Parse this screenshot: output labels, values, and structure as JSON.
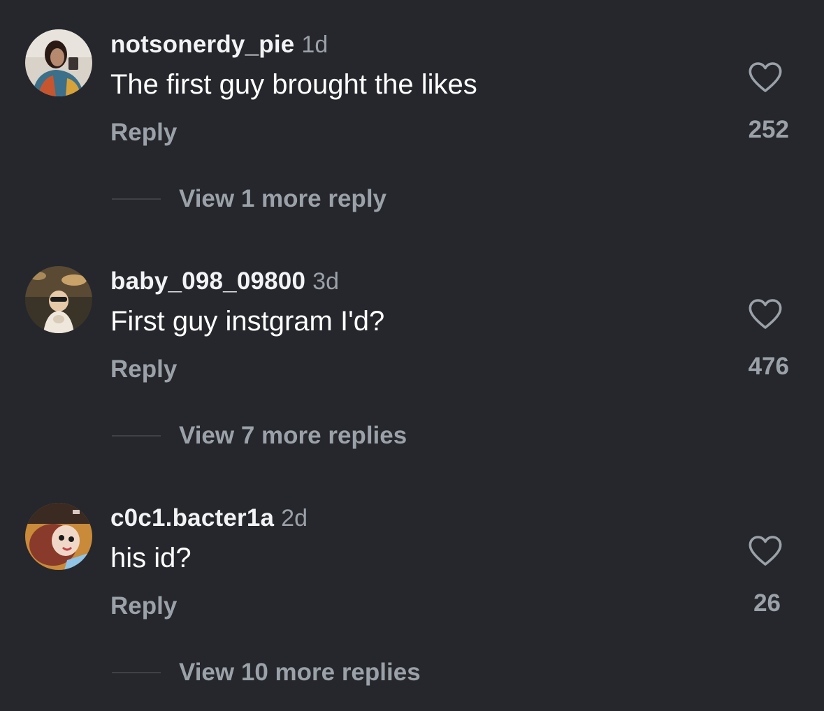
{
  "comments": [
    {
      "username": "notsonerdy_pie",
      "timestamp": "1d",
      "text": "The first guy brought the likes",
      "reply_label": "Reply",
      "like_count": "252",
      "view_replies_label": "View 1 more reply"
    },
    {
      "username": "baby_098_09800",
      "timestamp": "3d",
      "text": "First guy instgram I'd?",
      "reply_label": "Reply",
      "like_count": "476",
      "view_replies_label": "View 7 more replies"
    },
    {
      "username": "c0c1.bacter1a",
      "timestamp": "2d",
      "text": "his id?",
      "reply_label": "Reply",
      "like_count": "26",
      "view_replies_label": "View 10 more replies"
    }
  ],
  "icons": {
    "like": "heart-outline-icon"
  },
  "colors": {
    "background": "#25272c",
    "primary_text": "#ffffff",
    "secondary_text": "#9ba1a8"
  }
}
